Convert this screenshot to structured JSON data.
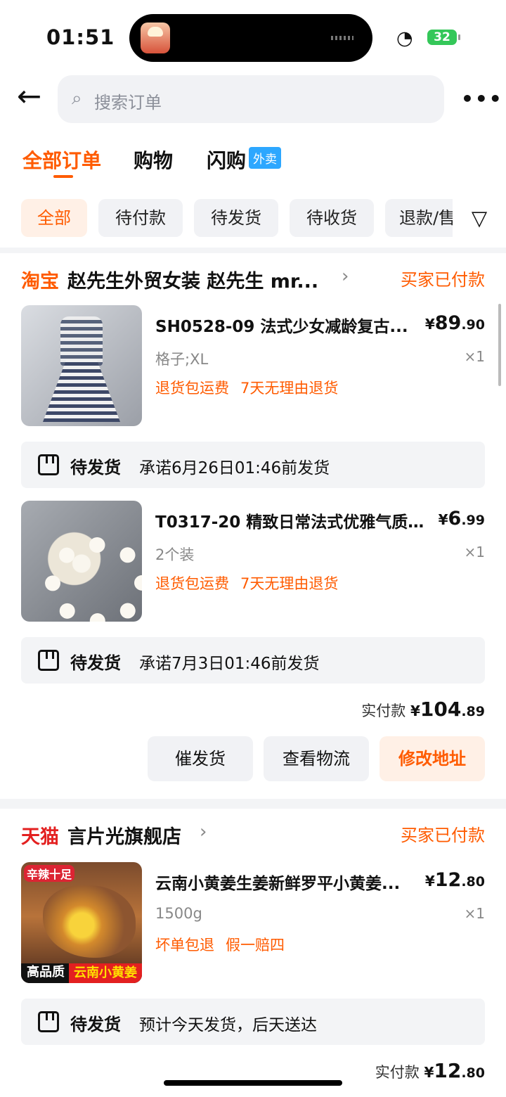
{
  "status": {
    "time": "01:51",
    "battery": "32"
  },
  "header": {
    "search_placeholder": "搜索订单"
  },
  "tabs": [
    {
      "label": "全部订单"
    },
    {
      "label": "购物"
    },
    {
      "label": "闪购"
    },
    {
      "badge": "外卖"
    }
  ],
  "filters": [
    "全部",
    "待付款",
    "待发货",
    "待收货",
    "退款/售"
  ],
  "orders": [
    {
      "platform": "淘宝",
      "shop": "赵先生外贸女装 赵先生 mr...",
      "status": "买家已付款",
      "items": [
        {
          "title": "SH0528-09 法式少女减龄复古...",
          "price_symbol": "¥",
          "price_main": "89",
          "price_decimal": ".90",
          "spec": "格子;XL",
          "qty": "×1",
          "promos": [
            "退货包运费",
            "7天无理由退货"
          ],
          "shipping": {
            "label": "待发货",
            "promise": "承诺6月26日01:46前发货"
          }
        },
        {
          "title": "T0317-20 精致日常法式优雅气质...",
          "price_symbol": "¥",
          "price_main": "6",
          "price_decimal": ".99",
          "spec": "2个装",
          "qty": "×1",
          "promos": [
            "退货包运费",
            "7天无理由退货"
          ],
          "shipping": {
            "label": "待发货",
            "promise": "承诺7月3日01:46前发货"
          }
        }
      ],
      "total_label": "实付款",
      "total_symbol": "¥",
      "total_main": "104",
      "total_decimal": ".89",
      "actions": [
        "催发货",
        "查看物流",
        "修改地址"
      ]
    },
    {
      "platform": "天猫",
      "shop": "言片光旗舰店",
      "status": "买家已付款",
      "items": [
        {
          "title": "云南小黄姜生姜新鲜罗平小黄姜...",
          "price_symbol": "¥",
          "price_main": "12",
          "price_decimal": ".80",
          "spec": "1500g",
          "qty": "×1",
          "promos": [
            "坏单包退",
            "假一赔四"
          ],
          "image_tags": [
            "辛辣十足",
            "高品质",
            "云南小黄姜"
          ],
          "shipping": {
            "label": "待发货",
            "promise": "预计今天发货，后天送达"
          }
        }
      ],
      "total_label": "实付款",
      "total_symbol": "¥",
      "total_main": "12",
      "total_decimal": ".80"
    }
  ],
  "colors": {
    "accent": "#ff5b00",
    "badge_blue": "#2da7ff",
    "tmall_red": "#e32020"
  }
}
